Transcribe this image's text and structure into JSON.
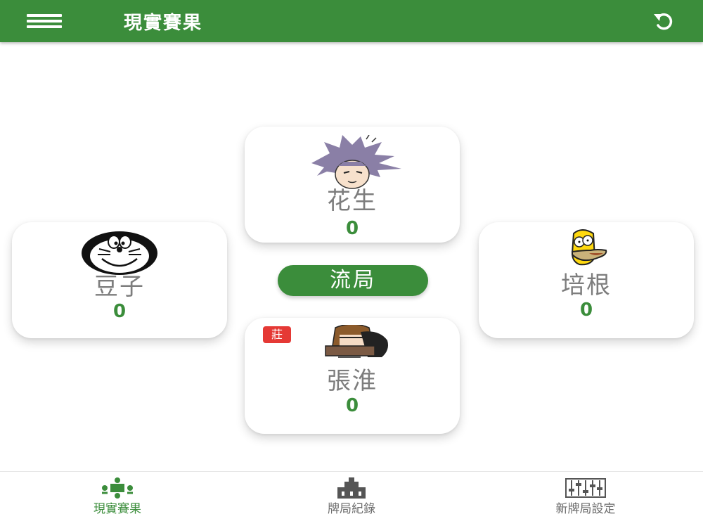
{
  "app": {
    "title": "現實賽果"
  },
  "players": {
    "north": {
      "name": "花生",
      "score": "0"
    },
    "west": {
      "name": "豆子",
      "score": "0"
    },
    "east": {
      "name": "培根",
      "score": "0"
    },
    "south": {
      "name": "張淮",
      "score": "0",
      "dealer_badge": "莊"
    }
  },
  "actions": {
    "draw_label": "流局"
  },
  "nav": {
    "items": [
      {
        "label": "現實賽果",
        "icon": "table-players-icon",
        "active": true
      },
      {
        "label": "牌局紀錄",
        "icon": "history-building-icon",
        "active": false
      },
      {
        "label": "新牌局設定",
        "icon": "sliders-settings-icon",
        "active": false
      }
    ]
  },
  "colors": {
    "primary": "#3b8d3b",
    "dealer": "#e53935",
    "name_text": "#7d7d7d"
  }
}
